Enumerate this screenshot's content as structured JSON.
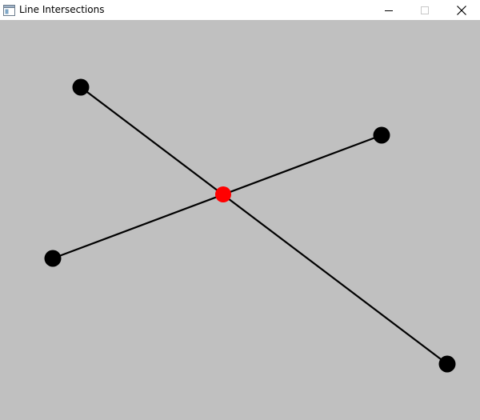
{
  "window": {
    "title": "Line Intersections",
    "controls": {
      "minimize_icon": "minimize-icon",
      "maximize_icon": "maximize-icon",
      "close_icon": "close-icon"
    }
  },
  "colors": {
    "canvas_background": "#c0c0c0",
    "line": "#000000",
    "endpoint": "#000000",
    "intersection": "#ff0000"
  }
}
